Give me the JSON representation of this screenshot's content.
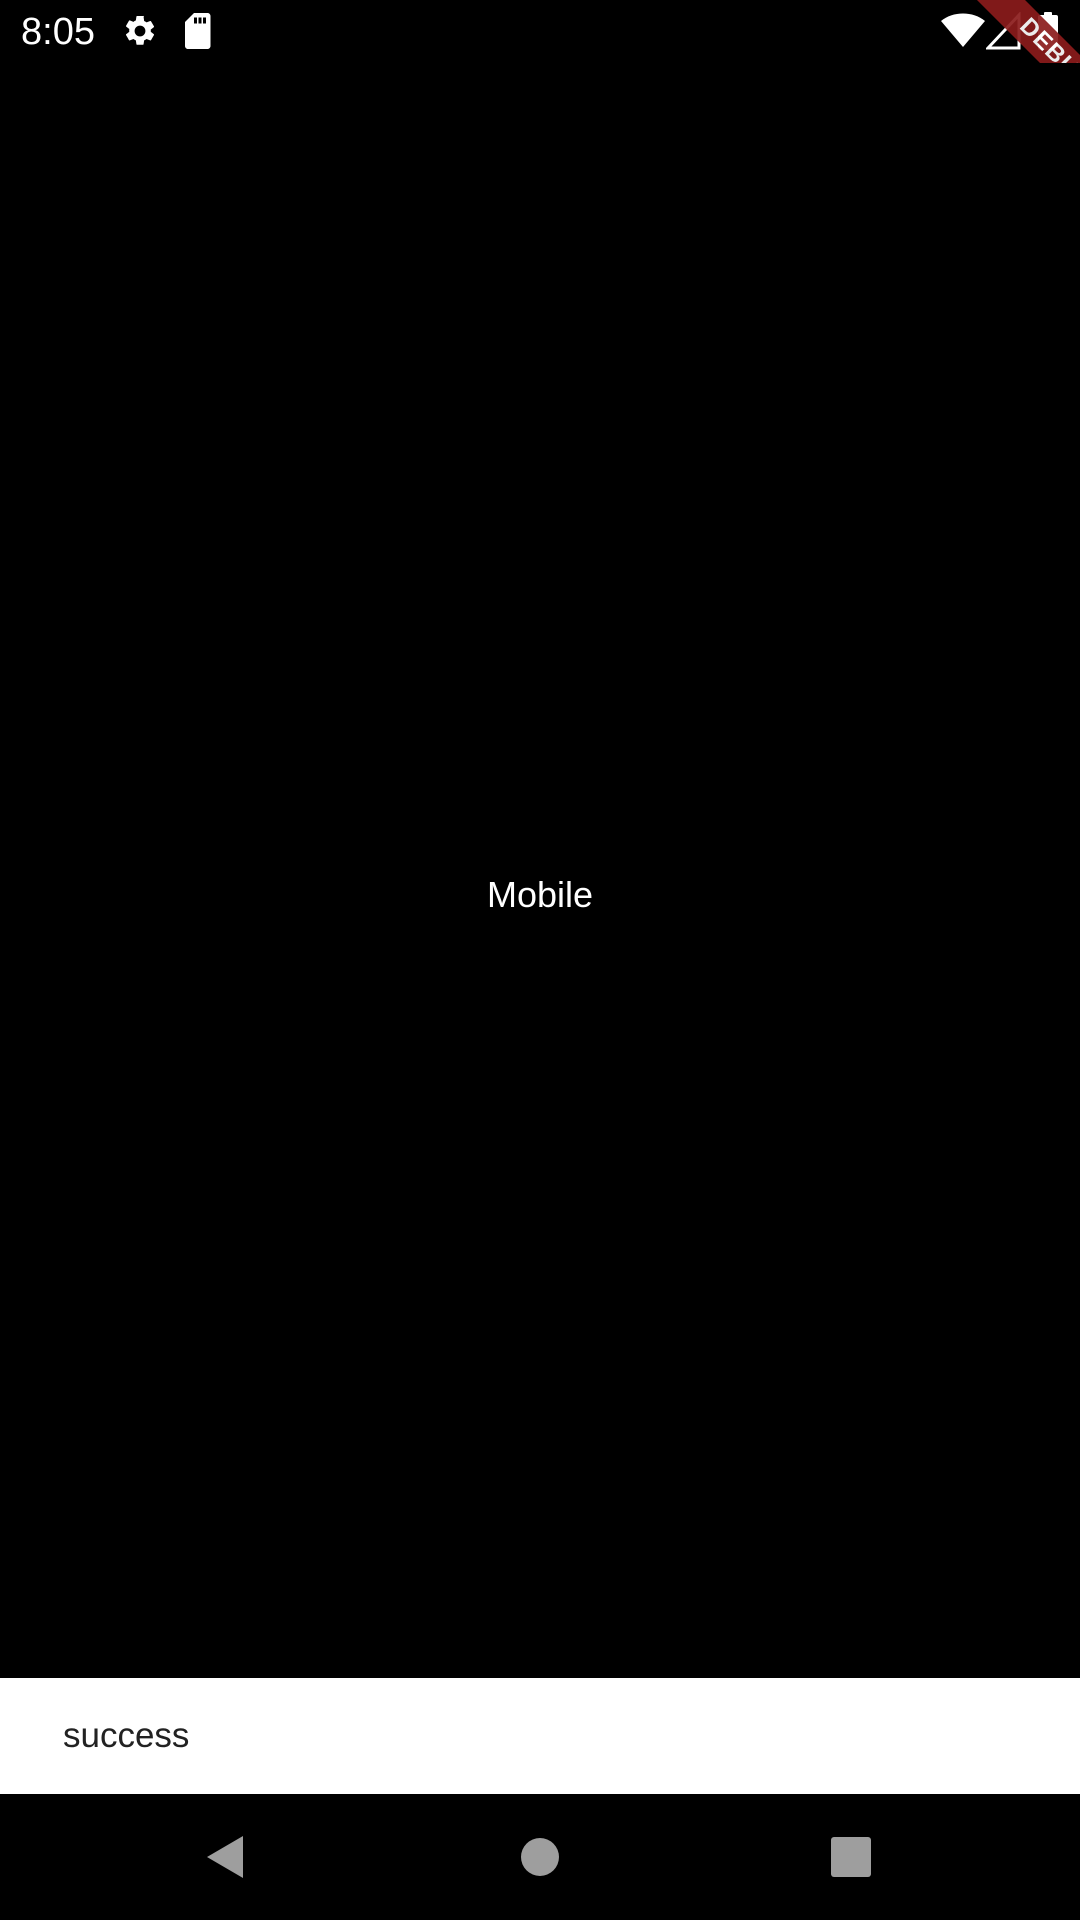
{
  "status_bar": {
    "time": "8:05",
    "icons_left": [
      "gear-icon",
      "sd-card-icon"
    ],
    "icons_right": [
      "wifi-icon",
      "cell-signal-icon",
      "battery-icon"
    ]
  },
  "debug_banner": {
    "label": "DEBUG",
    "color": "#8b1c1c"
  },
  "main": {
    "label": "Mobile",
    "background": "#000000"
  },
  "snackbar": {
    "message": "success"
  },
  "nav_bar": {
    "buttons": [
      "back-icon",
      "home-icon",
      "recents-icon"
    ]
  }
}
